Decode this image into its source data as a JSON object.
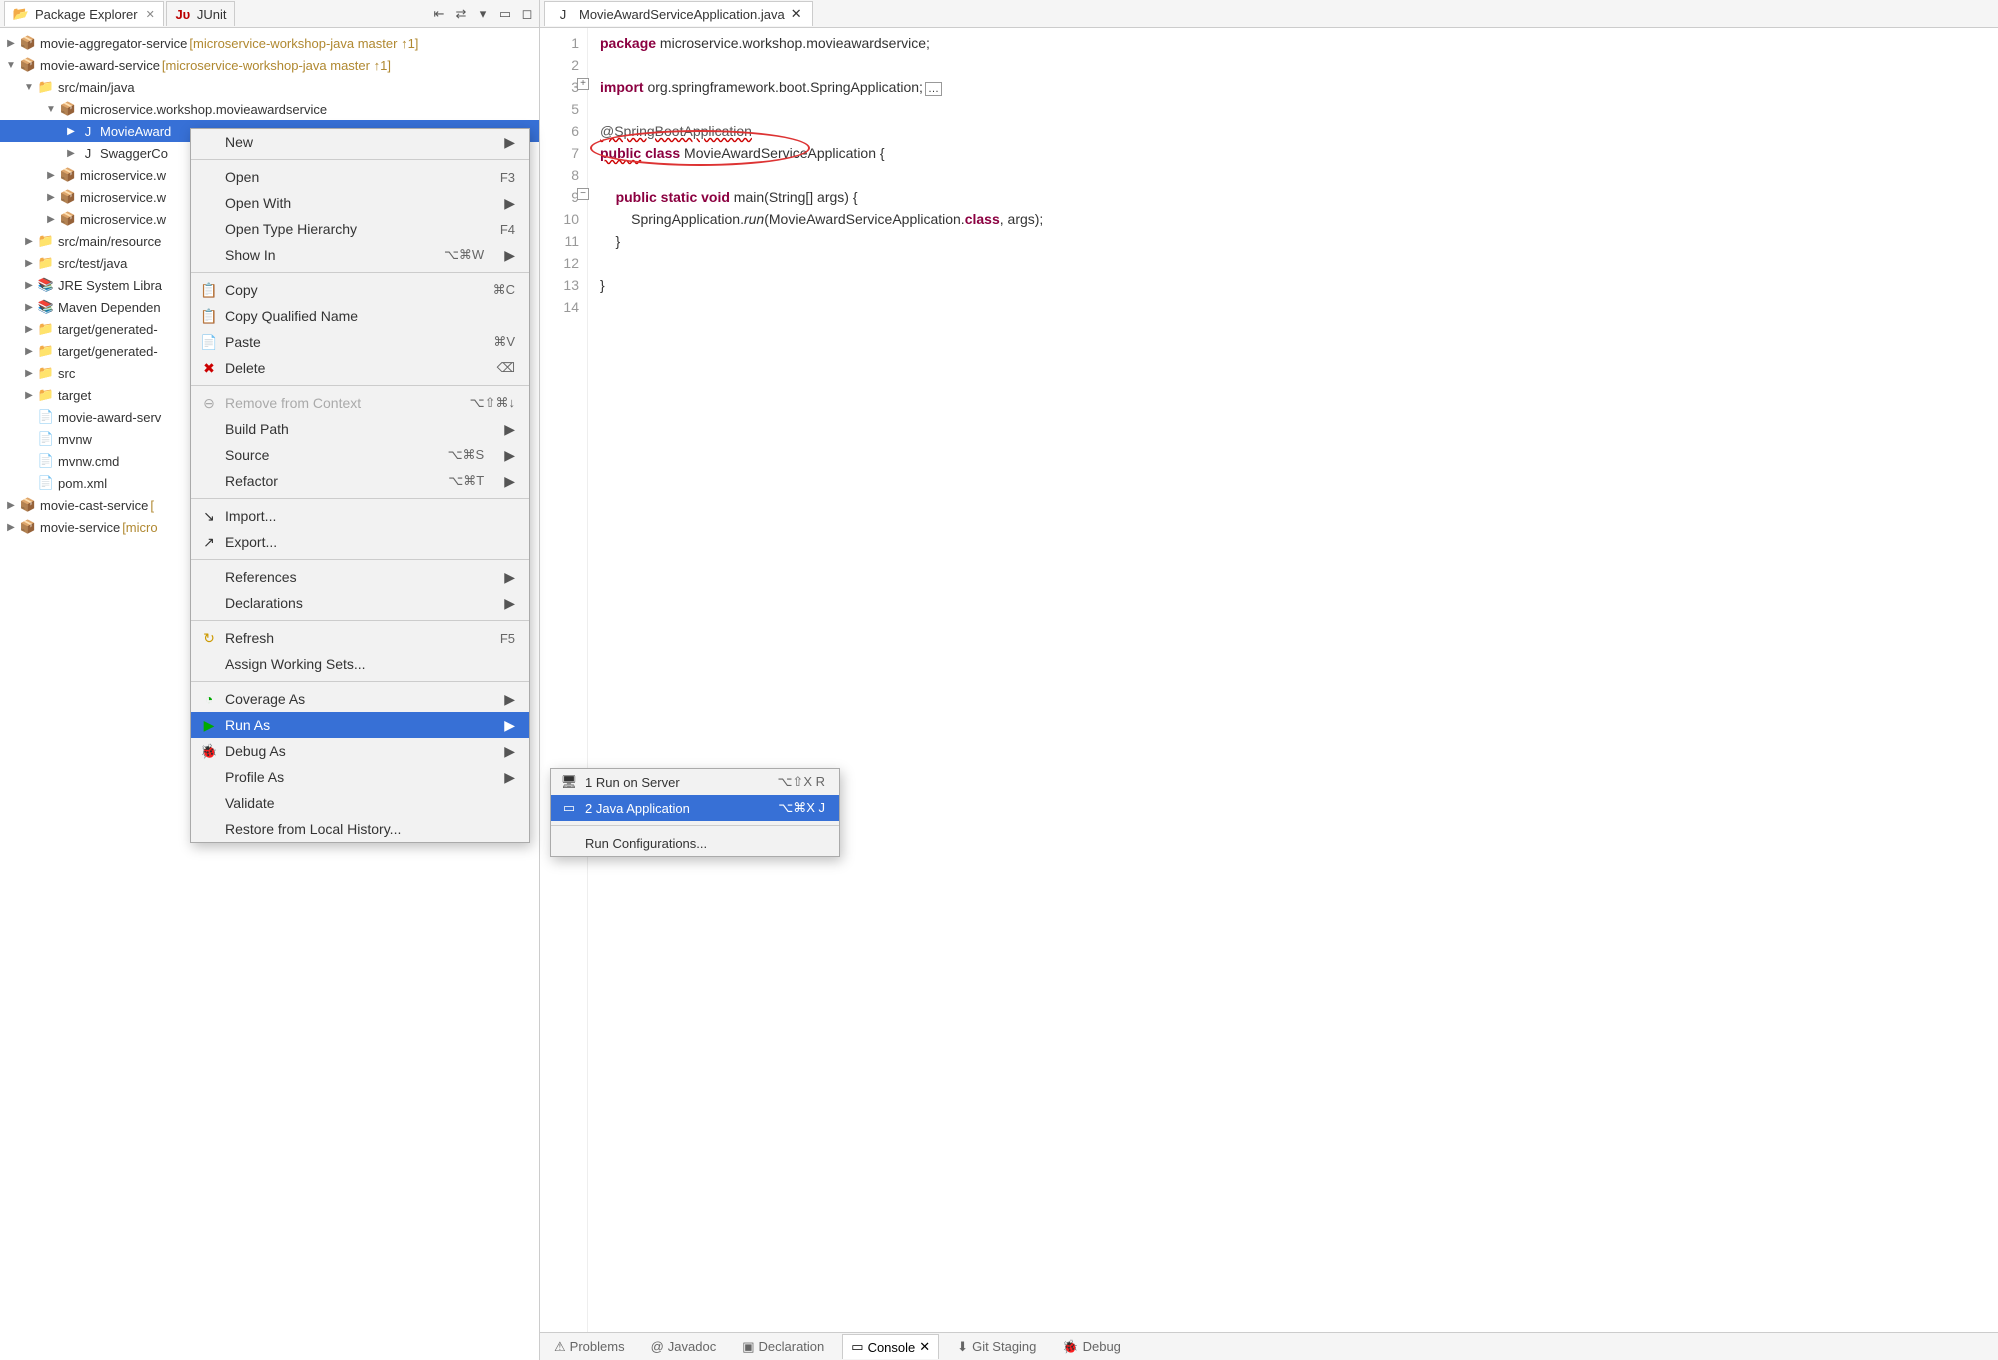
{
  "leftTabs": {
    "packageExplorer": "Package Explorer",
    "junit": "JUnit"
  },
  "tree": {
    "aggregator": {
      "name": "movie-aggregator-service",
      "decor": " [microservice-workshop-java master ↑1]"
    },
    "award": {
      "name": "movie-award-service",
      "decor": " [microservice-workshop-java master ↑1]"
    },
    "srcMainJava": "src/main/java",
    "pkg": "microservice.workshop.movieawardservice",
    "movieAwardFile": "MovieAward",
    "swaggerFile": "SwaggerCo",
    "pkgW1": "microservice.w",
    "pkgW2": "microservice.w",
    "pkgW3": "microservice.w",
    "srcMainRes": "src/main/resource",
    "srcTestJava": "src/test/java",
    "jre": "JRE System Libra",
    "maven": "Maven Dependen",
    "targetGen1": "target/generated-",
    "targetGen2": "target/generated-",
    "src": "src",
    "target": "target",
    "awardServFile": "movie-award-serv",
    "mvnw": "mvnw",
    "mvnwCmd": "mvnw.cmd",
    "pom": "pom.xml",
    "cast": {
      "name": "movie-cast-service",
      "decor": " ["
    },
    "movie": {
      "name": "movie-service",
      "decor": " [micro"
    }
  },
  "editor": {
    "tabTitle": "MovieAwardServiceApplication.java",
    "lines": {
      "l1": "package microservice.workshop.movieawardservice;",
      "l2": "",
      "l3": "import org.springframework.boot.SpringApplication;",
      "l5": "",
      "l6": "@SpringBootApplication",
      "l7": "public class MovieAwardServiceApplication {",
      "l8": "",
      "l9": "    public static void main(String[] args) {",
      "l10": "        SpringApplication.run(MovieAwardServiceApplication.class, args);",
      "l11": "    }",
      "l12": "",
      "l13": "}",
      "l14": ""
    }
  },
  "contextMenu": {
    "new": "New",
    "open": "Open",
    "openAccel": "F3",
    "openWith": "Open With",
    "openTypeH": "Open Type Hierarchy",
    "openTypeHAccel": "F4",
    "showIn": "Show In",
    "showInAccel": "⌥⌘W",
    "copy": "Copy",
    "copyAccel": "⌘C",
    "copyQN": "Copy Qualified Name",
    "paste": "Paste",
    "pasteAccel": "⌘V",
    "delete": "Delete",
    "deleteAccel": "⌫",
    "removeCtx": "Remove from Context",
    "removeCtxAccel": "⌥⇧⌘↓",
    "buildPath": "Build Path",
    "source": "Source",
    "sourceAccel": "⌥⌘S",
    "refactor": "Refactor",
    "refactorAccel": "⌥⌘T",
    "import": "Import...",
    "export": "Export...",
    "references": "References",
    "declarations": "Declarations",
    "refresh": "Refresh",
    "refreshAccel": "F5",
    "assignWS": "Assign Working Sets...",
    "coverageAs": "Coverage As",
    "runAs": "Run As",
    "debugAs": "Debug As",
    "profileAs": "Profile As",
    "validate": "Validate",
    "restore": "Restore from Local History..."
  },
  "submenu": {
    "runServer": "1 Run on Server",
    "runServerAccel": "⌥⇧X R",
    "javaApp": "2 Java Application",
    "javaAppAccel": "⌥⌘X J",
    "runConfig": "Run Configurations..."
  },
  "bottom": {
    "problems": "Problems",
    "javadoc": "Javadoc",
    "declaration": "Declaration",
    "console": "Console",
    "gitStaging": "Git Staging",
    "debug": "Debug"
  }
}
